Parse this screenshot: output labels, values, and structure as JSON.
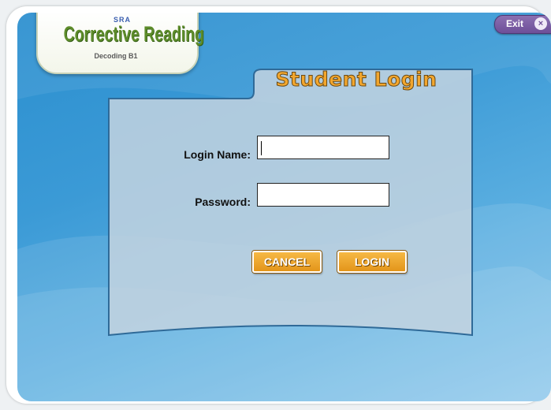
{
  "app": {
    "logo_brand": "SRA",
    "logo_title": "Corrective Reading",
    "logo_subtitle": "Decoding B1"
  },
  "header": {
    "exit_label": "Exit",
    "exit_icon": "close-icon"
  },
  "login_panel": {
    "title": "Student Login",
    "login_name_label": "Login Name:",
    "login_name_value": "",
    "password_label": "Password:",
    "password_value": "",
    "cancel_label": "CANCEL",
    "login_label": "LOGIN"
  },
  "colors": {
    "background_blue": "#3b9ad6",
    "panel": "#c3d3e0",
    "accent_orange": "#f2a62d",
    "exit_purple": "#6e4f98",
    "logo_green": "#5d8c2a"
  }
}
